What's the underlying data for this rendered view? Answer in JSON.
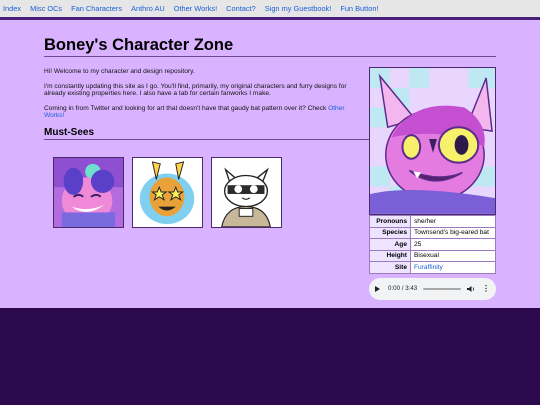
{
  "nav": {
    "items": [
      "Index",
      "Misc OCs",
      "Fan Characters",
      "Anthro AU",
      "Other Works!",
      "Contact?",
      "Sign my Guestbook!",
      "Fun Button!"
    ]
  },
  "page": {
    "title": "Boney's Character Zone",
    "intro": "Hi! Welcome to my character and design repository.",
    "updating": "I'm constantly updating this site as I go. You'll find, primarily, my original characters and furry designs for already existing properties here. I also have a tab for certain fanworks I make.",
    "coming_from": "Coming in from Twitter and looking for art that doesn't have that gaudy bat pattern over it? Check ",
    "other_works_link": "Other Works!",
    "must_sees_heading": "Must-Sees"
  },
  "profile": {
    "rows": [
      {
        "key": "Pronouns",
        "value": "she/her"
      },
      {
        "key": "Species",
        "value": "Townsend's big-eared bat"
      },
      {
        "key": "Age",
        "value": "25"
      },
      {
        "key": "Height",
        "value": "Bisexual"
      },
      {
        "key": "Site",
        "value": "Furaffinity"
      }
    ]
  },
  "audio": {
    "time": "0:00 / 3:43"
  },
  "colors": {
    "page_bg": "#d9b3ff",
    "footer_bg": "#2d0a4e",
    "link": "#1a5fd6",
    "nav_bg": "#e6e6e6"
  },
  "icons": [
    "play-icon",
    "volume-icon",
    "more-options-icon"
  ]
}
